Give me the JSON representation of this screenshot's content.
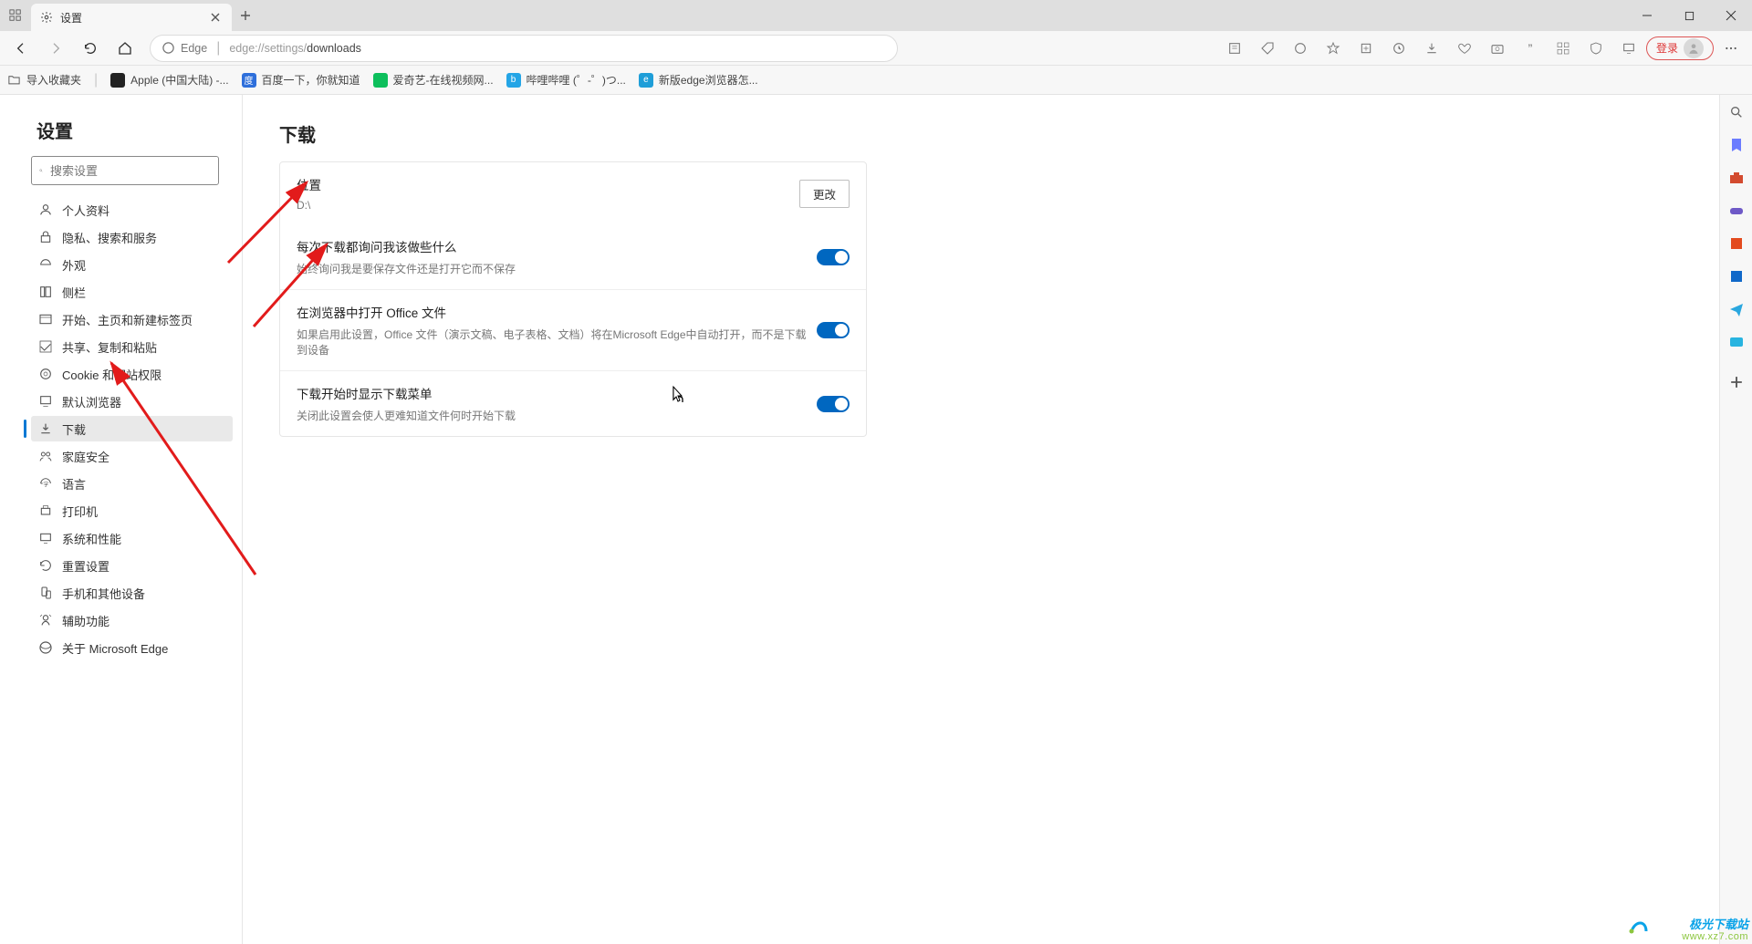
{
  "tab": {
    "title": "设置"
  },
  "address": {
    "site_label": "Edge",
    "url_prefix": "edge://settings/",
    "url_path": "downloads"
  },
  "toolbar": {
    "login": "登录"
  },
  "bookmarks": {
    "import": "导入收藏夹",
    "items": [
      {
        "label": "Apple (中国大陆) -..."
      },
      {
        "label": "百度一下，你就知道"
      },
      {
        "label": "爱奇艺-在线视频网..."
      },
      {
        "label": "哔哩哔哩 (゜-゜)つ..."
      },
      {
        "label": "新版edge浏览器怎..."
      }
    ]
  },
  "settings": {
    "title": "设置",
    "search_placeholder": "搜索设置",
    "nav": [
      "个人资料",
      "隐私、搜索和服务",
      "外观",
      "侧栏",
      "开始、主页和新建标签页",
      "共享、复制和粘贴",
      "Cookie 和网站权限",
      "默认浏览器",
      "下载",
      "家庭安全",
      "语言",
      "打印机",
      "系统和性能",
      "重置设置",
      "手机和其他设备",
      "辅助功能",
      "关于 Microsoft Edge"
    ],
    "active_index": 8
  },
  "page": {
    "heading": "下载",
    "location": {
      "label": "位置",
      "path": "D:\\",
      "button": "更改"
    },
    "rows": [
      {
        "title": "每次下载都询问我该做些什么",
        "desc": "始终询问我是要保存文件还是打开它而不保存",
        "on": true
      },
      {
        "title": "在浏览器中打开 Office 文件",
        "desc": "如果启用此设置，Office 文件（演示文稿、电子表格、文档）将在Microsoft Edge中自动打开，而不是下载到设备",
        "on": true
      },
      {
        "title": "下载开始时显示下载菜单",
        "desc": "关闭此设置会使人更难知道文件何时开始下载",
        "on": true
      }
    ]
  },
  "watermark": {
    "line1": "极光下载站",
    "line2": "www.xz7.com"
  }
}
